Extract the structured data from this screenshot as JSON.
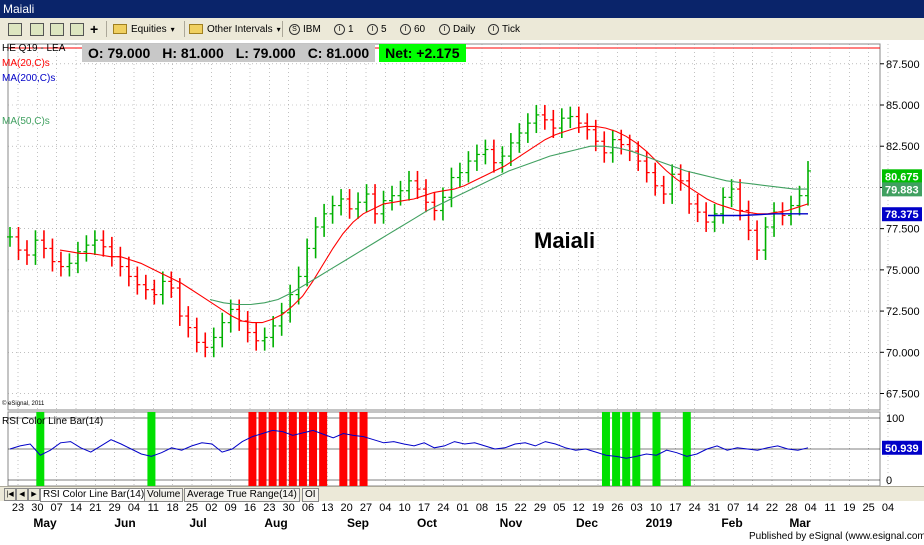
{
  "window": {
    "title": "Maiali"
  },
  "toolbar": {
    "equities_label": "Equities",
    "intervals_label": "Other Intervals",
    "symbol_label": "IBM",
    "interval_1": "1",
    "interval_5": "5",
    "interval_60": "60",
    "interval_daily": "Daily",
    "interval_tick": "Tick"
  },
  "header": {
    "symbol": "HE Q19 - LEA",
    "open": "O: 79.000",
    "high": "H: 81.000",
    "low": "L: 79.000",
    "close": "C: 81.000",
    "net": "Net: +2.175"
  },
  "studies": {
    "ma20": "MA(20,C)s",
    "ma200": "MA(200,C)s",
    "ma50": "MA(50,C)s",
    "rsi_title": "RSI Color Line Bar(14)"
  },
  "watermark": "Maiali",
  "copyright": "© eSignal, 2011",
  "publisher": "Published by eSignal (www.esignal.com)",
  "colors": {
    "red": "#ff0000",
    "green": "#00c000",
    "blue": "#0000c8",
    "ma50": "#40a060",
    "net_bg": "#00ff00"
  },
  "price_axis": {
    "ticks": [
      "87.500",
      "85.000",
      "82.500",
      "80.000",
      "77.500",
      "75.000",
      "72.500",
      "70.000",
      "67.500"
    ],
    "badge_green": "80.675",
    "badge_green2": "79.883",
    "badge_blue": "78.375"
  },
  "rsi_axis": {
    "ticks": [
      "100",
      "50",
      "0"
    ],
    "badge": "50.939"
  },
  "date_axis": {
    "days": [
      "23",
      "30",
      "07",
      "14",
      "21",
      "29",
      "04",
      "11",
      "18",
      "25",
      "02",
      "09",
      "16",
      "23",
      "30",
      "06",
      "13",
      "20",
      "27",
      "04",
      "10",
      "17",
      "24",
      "01",
      "08",
      "15",
      "22",
      "29",
      "05",
      "12",
      "19",
      "26",
      "03",
      "10",
      "17",
      "24",
      "31",
      "07",
      "14",
      "22",
      "28",
      "04",
      "11",
      "19",
      "25",
      "04"
    ],
    "months": [
      "May",
      "Jun",
      "Jul",
      "Aug",
      "Sep",
      "Oct",
      "Nov",
      "Dec",
      "2019",
      "Feb",
      "Mar"
    ]
  },
  "bottom_tabs": [
    "RSI Color Line Bar(14)",
    "Volume",
    "Average True Range(14)",
    "OI"
  ],
  "chart_data": {
    "type": "line",
    "title": "HE Q19 - LEA",
    "y_range": [
      66.5,
      88.7
    ],
    "rsi_range": [
      0,
      100
    ],
    "price_series": [
      {
        "name": "Price",
        "y": [
          77.0,
          76.2,
          75.9,
          76.8,
          76.3,
          75.5,
          75.2,
          75.4,
          76.1,
          76.5,
          76.8,
          76.4,
          75.8,
          75.2,
          74.6,
          74.1,
          73.8,
          73.5,
          74.3,
          73.9,
          72.2,
          71.5,
          70.6,
          70.3,
          70.9,
          71.8,
          72.6,
          71.9,
          71.2,
          70.7,
          70.9,
          71.6,
          72.4,
          73.5,
          74.6,
          76.3,
          77.6,
          78.4,
          78.9,
          79.3,
          78.7,
          79.1,
          79.6,
          78.4,
          79.2,
          79.5,
          79.8,
          80.4,
          79.9,
          79.1,
          78.6,
          79.4,
          80.6,
          80.9,
          81.6,
          82.0,
          82.3,
          81.5,
          81.9,
          82.7,
          83.3,
          83.9,
          84.4,
          84.1,
          83.6,
          84.2,
          84.3,
          83.9,
          83.5,
          82.8,
          82.1,
          82.9,
          82.6,
          82.2,
          81.6,
          80.9,
          80.1,
          79.6,
          80.8,
          80.4,
          79.0,
          78.5,
          77.9,
          78.4,
          79.4,
          79.9,
          78.6,
          77.4,
          76.2,
          77.6,
          78.5,
          78.3,
          78.9,
          79.5,
          81.0
        ]
      },
      {
        "name": "MA(20,C)s",
        "y": [
          76.2,
          76.1,
          76.0,
          76.0,
          75.9,
          75.8,
          75.8,
          75.6,
          75.4,
          75.1,
          74.8,
          74.5,
          74.2,
          73.8,
          73.4,
          73.0,
          72.6,
          72.2,
          71.9,
          71.8,
          71.8,
          72.0,
          72.3,
          72.8,
          73.4,
          74.3,
          75.3,
          76.3,
          77.2,
          77.9,
          78.4,
          78.7,
          79.0,
          79.1,
          79.2,
          79.3,
          79.5,
          79.7,
          79.8,
          79.9,
          80.1,
          80.4,
          80.7,
          81.0,
          81.3,
          81.7,
          82.1,
          82.5,
          82.9,
          83.2,
          83.4,
          83.6,
          83.7,
          83.7,
          83.6,
          83.4,
          83.1,
          82.7,
          82.2,
          81.6,
          81.0,
          80.5,
          80.1,
          79.7,
          79.3,
          79.0,
          78.8,
          78.6,
          78.5,
          78.4,
          78.4,
          78.5,
          78.6,
          78.8,
          79.0
        ]
      },
      {
        "name": "MA(50,C)s",
        "y": [
          73.2,
          73.0,
          72.9,
          72.9,
          73.0,
          73.2,
          73.6,
          74.1,
          74.6,
          75.1,
          75.6,
          76.1,
          76.6,
          77.1,
          77.6,
          78.1,
          78.6,
          79.0,
          79.4,
          79.8,
          80.2,
          80.6,
          81.0,
          81.3,
          81.6,
          81.9,
          82.1,
          82.3,
          82.5,
          82.5,
          82.4,
          82.2,
          81.9,
          81.6,
          81.3,
          81.0,
          80.8,
          80.6,
          80.4,
          80.3,
          80.2,
          80.1,
          80.0,
          79.9,
          79.9
        ]
      },
      {
        "name": "MA(200,C)s",
        "y": [
          78.3,
          78.3,
          78.4,
          78.4
        ]
      }
    ],
    "rsi_series": [
      {
        "name": "RSI Color Line Bar(14)",
        "y": [
          50,
          55,
          58,
          40,
          48,
          60,
          62,
          52,
          45,
          55,
          65,
          58,
          50,
          42,
          38,
          44,
          52,
          48,
          55,
          60,
          58,
          45,
          50,
          62,
          70,
          75,
          80,
          78,
          72,
          76,
          80,
          74,
          68,
          75,
          72,
          70,
          65,
          60,
          62,
          58,
          55,
          60,
          52,
          55,
          62,
          58,
          60,
          55,
          50,
          52,
          58,
          60,
          55,
          62,
          58,
          52,
          48,
          50,
          45,
          40,
          38,
          35,
          38,
          42,
          40,
          48,
          44,
          38,
          42,
          50,
          55,
          48,
          52,
          50,
          48,
          52,
          55,
          50,
          48,
          52
        ]
      }
    ]
  }
}
